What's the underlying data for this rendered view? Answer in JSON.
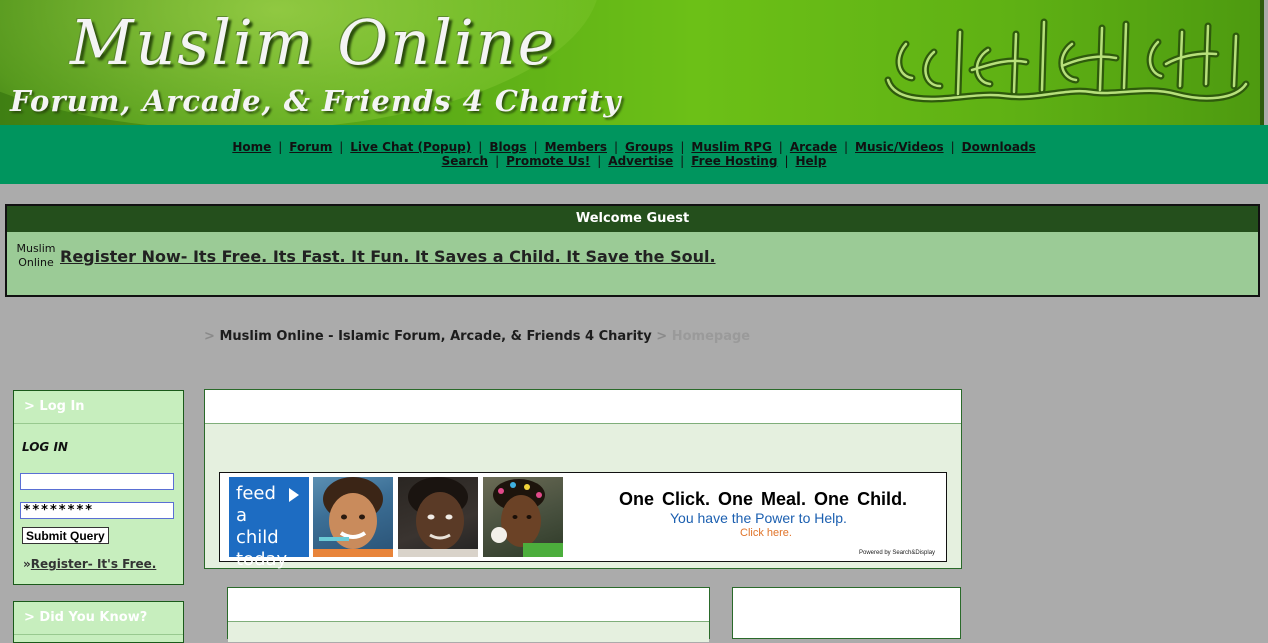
{
  "header": {
    "title": "Muslim Online",
    "subtitle": "Forum, Arcade, & Friends 4 Charity"
  },
  "nav": {
    "row1": [
      "Home",
      "Forum",
      "Live Chat (Popup)",
      "Blogs",
      "Members",
      "Groups",
      "Muslim RPG",
      "Arcade",
      "Music/Videos",
      "Downloads"
    ],
    "row2": [
      "Search",
      "Promote Us!",
      "Advertise",
      "Free Hosting",
      "Help"
    ],
    "separator": "|"
  },
  "welcome": {
    "heading": "Welcome Guest",
    "logo_text": "Muslim Online",
    "register_message": "Register Now- Its Free. Its Fast. It Fun. It Saves a Child. It Save the Soul."
  },
  "breadcrumb": {
    "arrow": ">",
    "site": "Muslim Online - Islamic Forum, Arcade, & Friends 4 Charity",
    "current": "Homepage"
  },
  "login": {
    "title": "> Log In",
    "subheading": "LOG IN",
    "username_value": "",
    "password_value": "********",
    "submit_label": "Submit Query",
    "register_prefix": "»",
    "register_label": "Register- It's Free."
  },
  "did_you_know": {
    "title": "> Did You Know?"
  },
  "ad": {
    "feed_text": "feed a child today",
    "headline": "One Click.   One Meal.   One Child.",
    "subline": "You have the Power to Help.",
    "cta": "Click here.",
    "powered_by": "Powered by Search&Display"
  },
  "colors": {
    "banner_green": "#6cc017",
    "nav_green": "#00955e",
    "welcome_header": "#244f1c",
    "welcome_body": "#9bcb96",
    "sidebar_box": "#c7eebe",
    "page_background": "#ababab",
    "ad_blue": "#1d6cc2",
    "ad_orange": "#e0742a"
  },
  "icons": {
    "calligraphy": "bismillah-calligraphy-icon",
    "play": "play-arrow-icon"
  }
}
